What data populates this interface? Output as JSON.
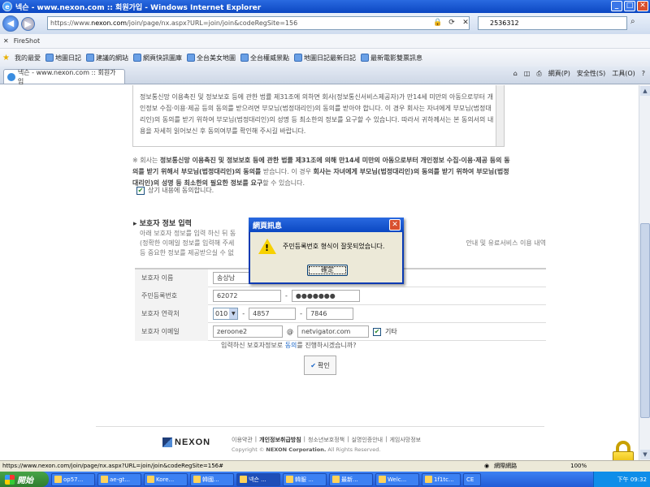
{
  "window": {
    "title": "넥슨 - www.nexon.com :: 회원가입 - Windows Internet Explorer",
    "min": "_",
    "max": "□",
    "close": "✕"
  },
  "address": {
    "scheme": "https://www.",
    "domain": "nexon.com",
    "path": "/join/page/nx.aspx?URL=join/join&codeRegSite=156",
    "search_value": "2536312"
  },
  "fireshot": {
    "close": "✕",
    "label": "FireShot"
  },
  "favorites": {
    "label": "我的最愛",
    "items": [
      {
        "label": "地圖日記"
      },
      {
        "label": "建議的網站"
      },
      {
        "label": "網頁快訊圖庫"
      },
      {
        "label": "全台美女地圖"
      },
      {
        "label": "全台權威景點"
      },
      {
        "label": "地圖日記最新日記"
      },
      {
        "label": "最新電影雙票訊息"
      }
    ]
  },
  "tab": {
    "label": "넥슨 - www.nexon.com :: 회원가입"
  },
  "commandbar": {
    "page": "網頁(P)",
    "safety": "安全性(S)",
    "tools": "工具(O)",
    "help": "?"
  },
  "terms": {
    "text": "정보통신망 이용촉진 및 정보보호 등에 관한 법률 제31조에 의하면 회사(정보통신서비스제공자)가 만14세 미만의 아동으로부터 개인정보 수집·이용·제공 등의 동의를 받으려면 부모님(법정대리인)의 동의를 받아야 합니다. 이 경우 회사는 자녀에게 부모님(법정대리인)의 동의를 받기 위하여 부모님(법정대리인)의 성명 등 최소한의 정보를 요구할 수 있습니다. 따라서 귀하께서는 본 동의서의 내용을 자세히 읽어보신 후 동의여부를 확인해 주시길 바랍니다."
  },
  "notice": {
    "mark": "※",
    "part1": "회사는 ",
    "bold1": "정보통신망 이용촉진 및 정보보호 등에 관한 법률 제31조에 의해 만14세 미만의 아동으로부터 개인정보 수집·이용·제공 등의 동의를 받기 위해서 부모님(법정대리인)의 동의를",
    "part2": " 받습니다. 이 경우 ",
    "bold2": "회사는 자녀에게 부모님(법정대리인)의 동의를 받기 위하여 부모님(법정대리인)의 성명 등 최소한의 필요한 정보를 요구",
    "part3": "할 수 있습니다."
  },
  "agree": {
    "check": "✔",
    "label": "상기 내용에 동의합니다."
  },
  "guardian": {
    "title": "보호자 정보 입력",
    "desc1": "아래 보호자 정보를 입력 하신 뒤 동",
    "desc2": "(정확한 이메일 정보를 입력해 주세",
    "desc2b": "안내 및 유료서비스 이용 내역",
    "desc3": "등 중요한 정보를 제공받으실 수 없",
    "labels": {
      "name": "보호자 이름",
      "ssn": "주민등록번호",
      "phone": "보호자 연락처",
      "email": "보호자 이메일"
    },
    "name_value": "송상남",
    "ssn_front": "62072",
    "ssn_back": "●●●●●●●",
    "phone_prefix": "010",
    "phone_mid": "4857",
    "phone_last": "7846",
    "dash": "-",
    "email_id": "zeroone2",
    "at": "@",
    "email_domain": "netvigator.com",
    "etc_label": "기타"
  },
  "confirm": {
    "prefix": "입력하신 보호자정보로 ",
    "highlight": "동의",
    "suffix": "를 진행하시겠습니까?",
    "ok": "확인"
  },
  "footer": {
    "logo": "NEXON",
    "links": [
      "이용약관",
      "개인정보취급방침",
      "청소년보호정책",
      "실명인증안내",
      "게임사망정보"
    ],
    "sep": "|",
    "copyright_prefix": "Copyright ©",
    "copyright_bold": "NEXON Corporation.",
    "copyright_suffix": " All Rights Reserved."
  },
  "dialog": {
    "title": "網頁訊息",
    "message": "주민등록번호 형식이 잘못되었습니다.",
    "ok": "確定",
    "close": "✕"
  },
  "status": {
    "url": "https://www.nexon.com/join/page/nx.aspx?URL=join/join&codeRegSite=156#",
    "zone": "網際網路",
    "zoom": "100%"
  },
  "taskbar": {
    "start": "開始",
    "items": [
      "op57...",
      "ae-gt...",
      "Kore...",
      "韓國...",
      "넥슨 ...",
      "韓服 ...",
      "最新...",
      "Welc...",
      "1f1tc...",
      "CE"
    ],
    "clock": "下午 09:32"
  }
}
